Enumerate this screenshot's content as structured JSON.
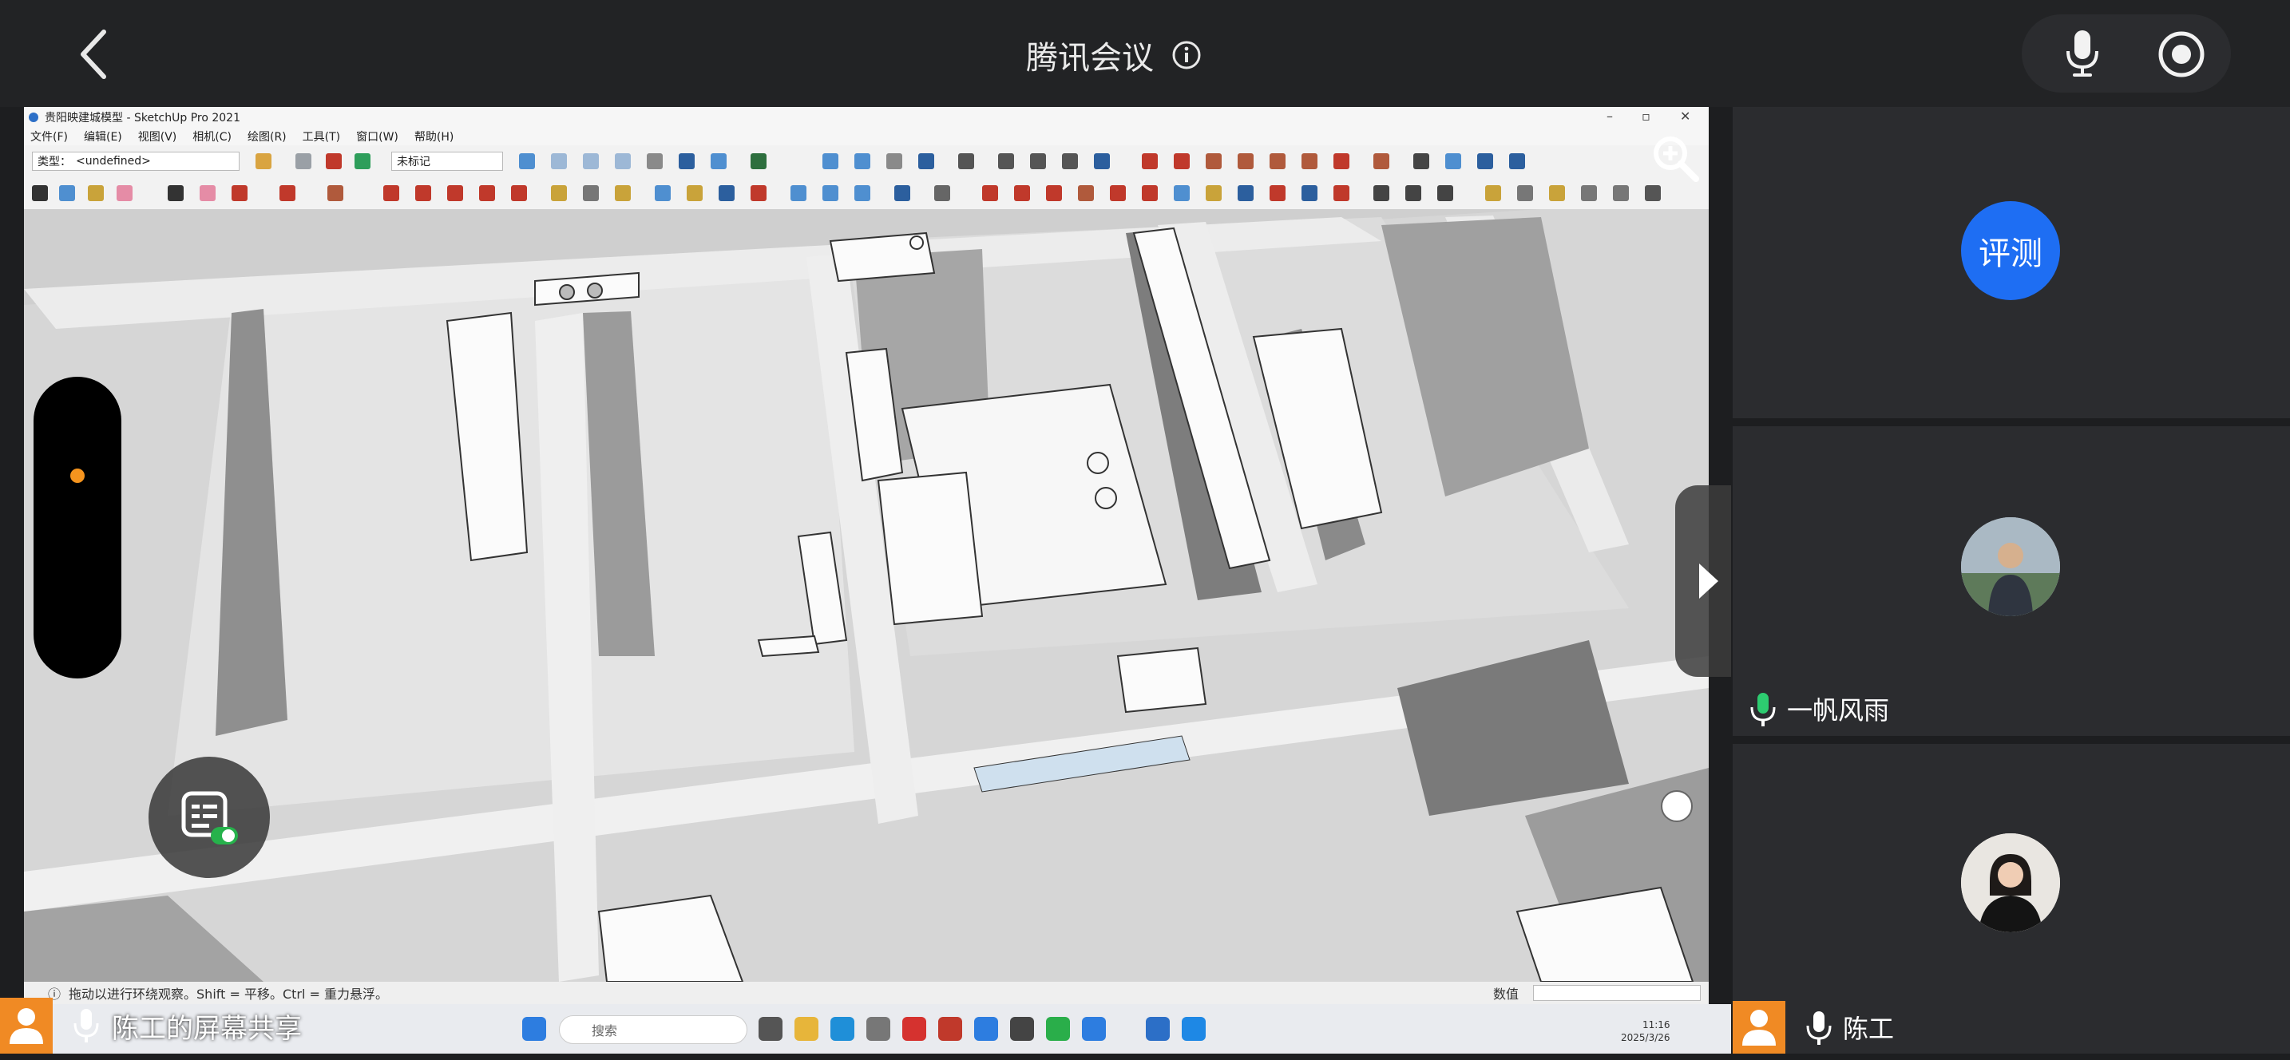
{
  "meeting": {
    "title": "腾讯会议",
    "share_label": "陈工的屏幕共享"
  },
  "sketchup": {
    "window_title": "贵阳映建城模型 - SketchUp Pro 2021",
    "menu": [
      "文件(F)",
      "编辑(E)",
      "视图(V)",
      "相机(C)",
      "绘图(R)",
      "工具(T)",
      "窗口(W)",
      "帮助(H)"
    ],
    "type_label": "类型：",
    "type_value": "<undefined>",
    "tag_value": "未标记",
    "status_text": "拖动以进行环绕观察。Shift = 平移。Ctrl = 重力悬浮。",
    "value_label": "数值"
  },
  "taskbar": {
    "search_placeholder": "搜索",
    "time": "11:16",
    "date": "2025/3/26"
  },
  "participants": [
    {
      "avatar_text": "评测",
      "name": ""
    },
    {
      "name": "一帆风雨"
    },
    {
      "name": "陈工"
    }
  ],
  "colors": {
    "topbar": "#222325",
    "tile": "#2b2c2f",
    "accent_blue": "#1e6ef3",
    "orange": "#f08a24",
    "mic_green": "#2dcc70"
  }
}
